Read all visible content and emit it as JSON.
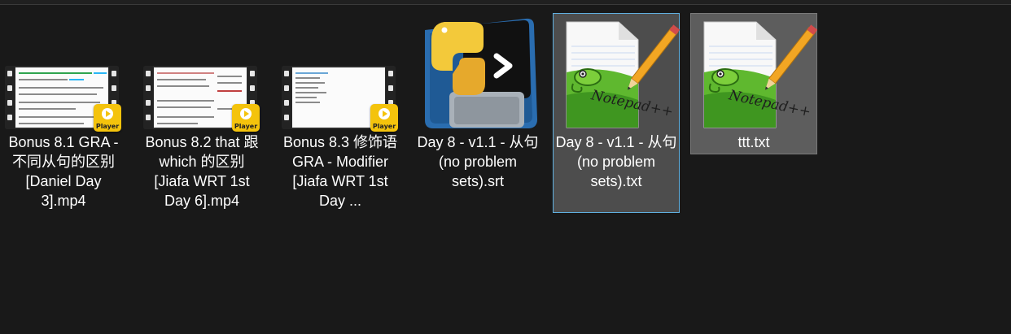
{
  "files": [
    {
      "name": "Bonus 8.1 GRA - 不同从句的区别 [Daniel Day 3].mp4",
      "type": "video",
      "badge": "Player"
    },
    {
      "name": "Bonus 8.2 that 跟 which 的区别 [Jiafa WRT 1st Day 6].mp4",
      "type": "video",
      "badge": "Player"
    },
    {
      "name": "Bonus 8.3 修饰语GRA - Modifier [Jiafa WRT 1st Day ...",
      "type": "video",
      "badge": "Player"
    },
    {
      "name": "Day 8 - v1.1 - 从句 (no problem sets).srt",
      "type": "python-file"
    },
    {
      "name": "Day 8 - v1.1 - 从句 (no problem sets).txt",
      "type": "notepad-file"
    },
    {
      "name": "ttt.txt",
      "type": "notepad-file"
    }
  ],
  "colors": {
    "background": "#191919",
    "selected": "#5d5d5d",
    "focus_border": "#60b0e0",
    "badge": "#f4c30c"
  }
}
